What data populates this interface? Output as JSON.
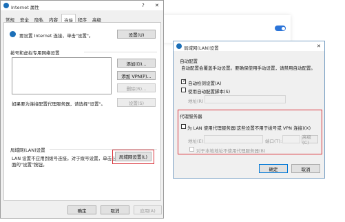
{
  "bg": {
    "toggle_color": "#2b74d8"
  },
  "inet": {
    "title": "Internet 属性",
    "help": "?",
    "close": "✕",
    "tabs": [
      "常规",
      "安全",
      "隐私",
      "内容",
      "连接",
      "程序",
      "高级"
    ],
    "active_tab": "连接",
    "setup_text": "要设置 Internet 连接，单击\"设置\"。",
    "setup_button": "设置(U)",
    "dialup_heading": "拨号和虚拟专用网络设置",
    "add_button": "添加(D)...",
    "add_vpn_button": "添加 VPN(P)...",
    "delete_button": "删除(R)...",
    "settings_button": "设置(S)",
    "proxy_hint": "如果要为连接配置代理服务器，请选择\"设置\"。",
    "lan_heading": "局域网(LAN)设置",
    "lan_desc_1": "LAN 设置不应用到拨号连接。对于拨号设置，单击上",
    "lan_desc_2": "面的\"设置\"按钮。",
    "lan_button": "局域网设置(L)",
    "ok": "确定",
    "cancel": "取消",
    "apply": "应用(A)"
  },
  "lan": {
    "title": "局域网(LAN)设置",
    "close": "✕",
    "auto_heading": "自动配置",
    "auto_desc": "自动配置会覆盖手动设置。要确保使用手动设置，请禁用自动配置。",
    "auto_detect": "自动检测设置(A)",
    "auto_script": "使用自动配置脚本(S)",
    "address_label": "地址(R)",
    "proxy_heading": "代理服务器",
    "use_proxy": "为 LAN 使用代理服务器(这些设置不用于拨号或 VPN 连接)(X)",
    "proxy_address": "地址(E):",
    "port_label": "端口(T):",
    "advanced": "高级(C)",
    "bypass_local": "对于本地地址不使用代理服务器(B)",
    "ok": "确定",
    "cancel": "取消"
  },
  "highlight_color": "#d9323a"
}
